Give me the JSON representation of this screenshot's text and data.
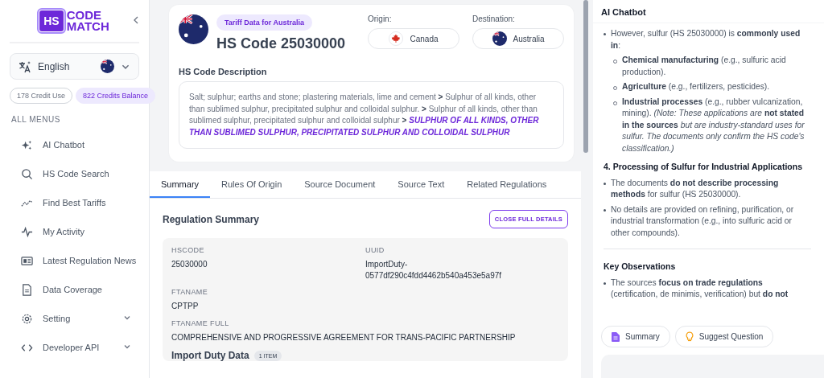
{
  "sidebar": {
    "logo_badge": "HS",
    "logo_text": [
      "CODE",
      "MATCH"
    ],
    "language": "English",
    "credits": [
      {
        "label": "178 Credit Use",
        "kind": "used"
      },
      {
        "label": "822 Credits Balance",
        "kind": "balance"
      }
    ],
    "section_title": "ALL MENUS",
    "items": [
      {
        "label": "AI Chatbot",
        "expandable": false
      },
      {
        "label": "HS Code Search",
        "expandable": false
      },
      {
        "label": "Find Best Tariffs",
        "expandable": false
      },
      {
        "label": "My Activity",
        "expandable": false
      },
      {
        "label": "Latest Regulation News",
        "expandable": false
      },
      {
        "label": "Data Coverage",
        "expandable": false
      },
      {
        "label": "Setting",
        "expandable": true
      },
      {
        "label": "Developer API",
        "expandable": true
      }
    ]
  },
  "header": {
    "badge": "Tariff Data for Australia",
    "title": "HS Code 25030000",
    "origin": {
      "label": "Origin:",
      "value": "Canada"
    },
    "destination": {
      "label": "Destination:",
      "value": "Australia"
    },
    "description_label": "HS Code Description",
    "description": "Salt; sulphur; earths and stone; plastering materials, lime and cement **>** Sulphur of all kinds, other than sublimed sulphur, precipitated sulphur and colloidal sulphur. **>** Sulphur of all kinds, other than sublimed sulphur, precipitated sulphur and colloidal sulphur **>**",
    "highlight": "SULPHUR OF ALL KINDS, OTHER THAN SUBLIMED SULPHUR, PRECIPITATED SULPHUR AND COLLOIDAL SULPHUR"
  },
  "tabs": [
    {
      "label": "Summary",
      "selected": true
    },
    {
      "label": "Rules Of Origin",
      "selected": false
    },
    {
      "label": "Source Document",
      "selected": false
    },
    {
      "label": "Source Text",
      "selected": false
    },
    {
      "label": "Related Regulations",
      "selected": false
    }
  ],
  "summary": {
    "title": "Regulation Summary",
    "button": "CLOSE FULL DETAILS",
    "rows": [
      [
        {
          "label": "HSCODE",
          "value": "25030000"
        },
        {
          "label": "UUID",
          "value": "ImportDuty-0577df290c4fdd4462b540a453e5a97f"
        }
      ],
      [
        {
          "label": "FTANAME",
          "value": "CPTPP"
        }
      ],
      [
        {
          "label": "FTANAME FULL",
          "value": "COMPREHENSIVE AND PROGRESSIVE AGREEMENT FOR TRANS-PACIFIC PARTNERSHIP"
        }
      ]
    ],
    "import_title": "Import Duty Data",
    "import_count": "1 ITEM"
  },
  "chat": {
    "title": "AI Chatbot",
    "blocks": [
      {
        "kind": "bullet",
        "text": "However, sulfur (HS 25030000) is **commonly used in**:"
      },
      {
        "kind": "subbullet",
        "text": "**Chemical manufacturing** (e.g., sulfuric acid production)."
      },
      {
        "kind": "subbullet",
        "text": "**Agriculture** (e.g., fertilizers, pesticides)."
      },
      {
        "kind": "subbullet",
        "text": "**Industrial processes** (e.g., rubber vulcanization, mining). *(Note: These applications are* **not stated in the sources** *but are industry-standard uses for sulfur. The documents only confirm the HS code's classification.)*"
      },
      {
        "kind": "heading",
        "text": "4. Processing of Sulfur for Industrial Applications"
      },
      {
        "kind": "bullet",
        "text": "The documents **do not describe processing methods** for sulfur (HS 25030000)."
      },
      {
        "kind": "bullet",
        "text": "No details are provided on refining, purification, or industrial transformation (e.g., into sulfuric acid or other compounds)."
      },
      {
        "kind": "divider"
      },
      {
        "kind": "heading",
        "text": "Key Observations"
      },
      {
        "kind": "bullet",
        "text": "The sources **focus on trade regulations** (certification, de minimis, verification) but **do not**"
      }
    ],
    "actions": [
      {
        "label": "Summary",
        "kind": "summary"
      },
      {
        "label": "Suggest Question",
        "kind": "suggest"
      }
    ]
  }
}
